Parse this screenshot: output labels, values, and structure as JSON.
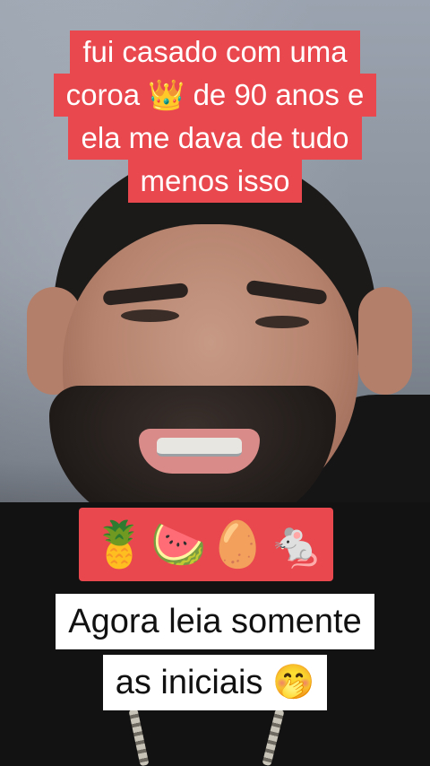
{
  "caption": {
    "lines": [
      "fui casado com uma",
      "coroa 👑 de 90 anos e",
      "ela me dava de tudo",
      "menos isso"
    ]
  },
  "emoji_row": {
    "items": [
      "🍍",
      "🍉",
      "🥚",
      "🐁"
    ]
  },
  "bottom_caption": {
    "line1": "Agora leia somente",
    "line2": "as iniciais 🤭"
  },
  "colors": {
    "caption_red": "#e8484e",
    "caption_text": "#ffffff",
    "bottom_bg": "#ffffff",
    "bottom_text": "#111111"
  }
}
